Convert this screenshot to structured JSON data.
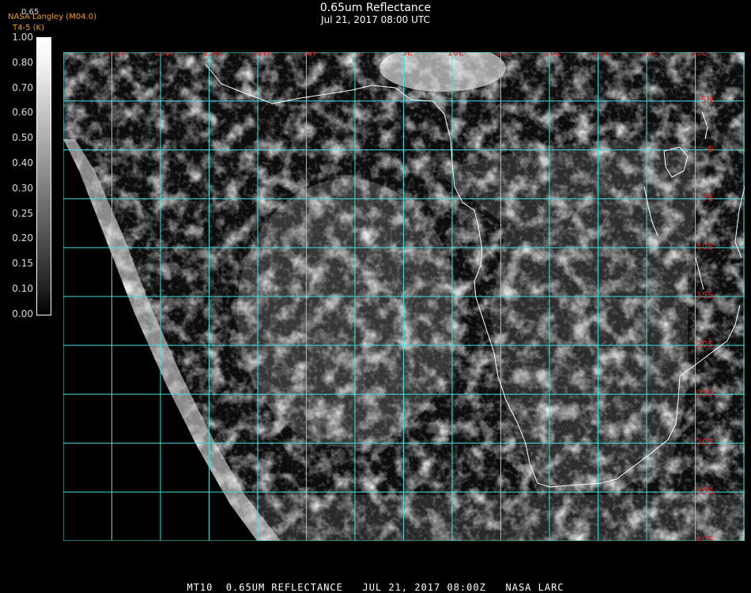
{
  "header": {
    "title": "0.65um Reflectance",
    "subtitle": "Jul 21, 2017 08:00 UTC",
    "credit_line1": "NASA Langley (M04.0)",
    "credit_line2": "T4-5 (K)",
    "pct_label": "0.65"
  },
  "colorbar": {
    "labels": [
      "1.00",
      "0.80",
      "0.70",
      "0.60",
      "0.50",
      "0.40",
      "0.30",
      "0.25",
      "0.20",
      "0.15",
      "0.10",
      "0.00"
    ]
  },
  "map": {
    "lon_labels": [
      "25W",
      "20W",
      "15W",
      "10W",
      "5W",
      "0",
      "5E",
      "10E",
      "15E",
      "20E",
      "25E",
      "30E",
      "35E"
    ],
    "lat_labels": [
      "5N",
      "0",
      "5S",
      "10S",
      "15S",
      "20S",
      "25S",
      "30S",
      "35S",
      "40S"
    ],
    "grid_color": "#40e0e0",
    "label_color": "#e02020",
    "coast_color": "#ffffff"
  },
  "footer": {
    "text": "MT10  0.65UM REFLECTANCE   JUL 21, 2017 08:00Z   NASA LARC"
  }
}
